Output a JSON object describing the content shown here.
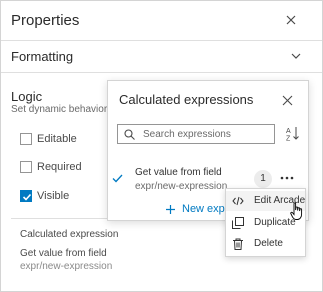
{
  "panel": {
    "title": "Properties",
    "formatting_label": "Formatting"
  },
  "logic": {
    "title": "Logic",
    "description": "Set dynamic behavior",
    "checkboxes": [
      {
        "label": "Editable",
        "checked": false
      },
      {
        "label": "Required",
        "checked": false
      },
      {
        "label": "Visible",
        "checked": true
      }
    ],
    "calculated_expression_label": "Calculated expression",
    "calculated_expression_title": "Get value from field",
    "calculated_expression_path": "expr/new-expression"
  },
  "popover": {
    "title": "Calculated expressions",
    "search_placeholder": "Search expressions",
    "item": {
      "title": "Get value from field",
      "path": "expr/new-expression",
      "count": "1",
      "selected": true
    },
    "new_expression_label": "New expr"
  },
  "context_menu": {
    "items": [
      {
        "label": "Edit Arcade",
        "icon": "code-icon"
      },
      {
        "label": "Duplicate",
        "icon": "duplicate-icon"
      },
      {
        "label": "Delete",
        "icon": "trash-icon"
      }
    ]
  },
  "colors": {
    "accent": "#007ac2",
    "text": "#323232",
    "border": "#d4d4d4"
  }
}
